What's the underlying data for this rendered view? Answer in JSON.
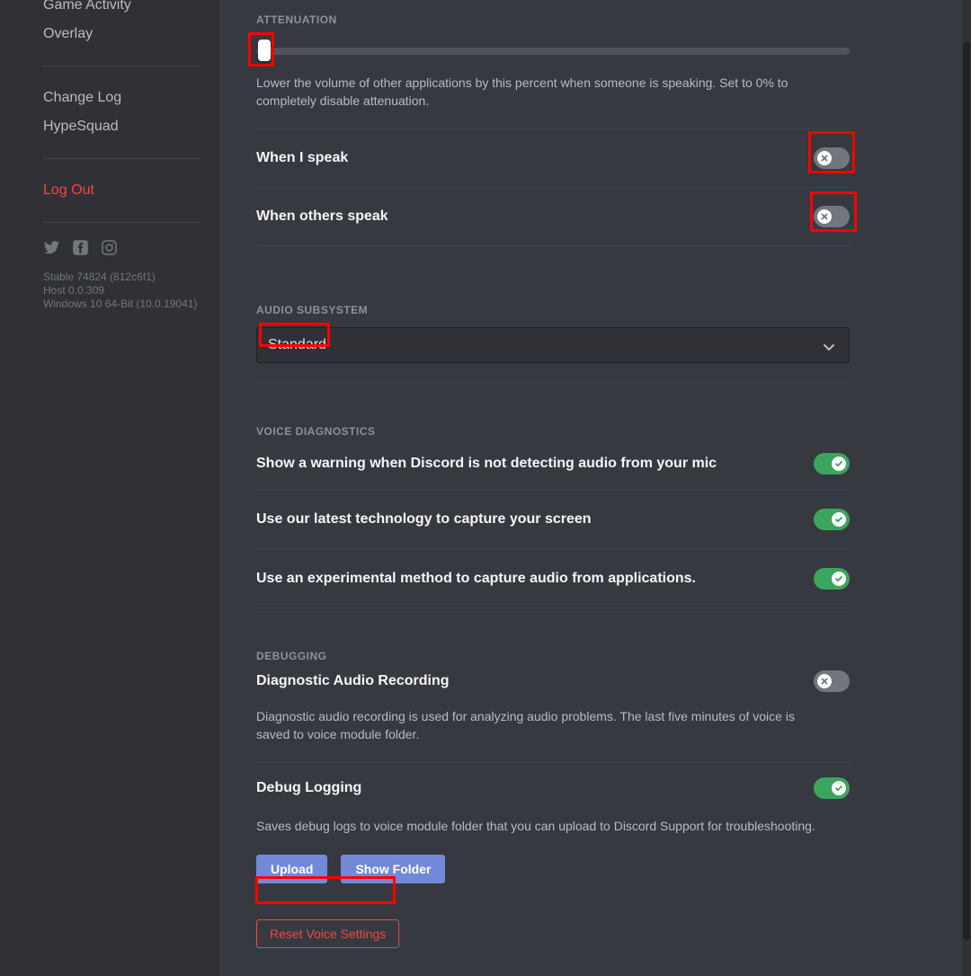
{
  "sidebar": {
    "nav_top": [
      {
        "label": "Game Activity",
        "style": "normal"
      },
      {
        "label": "Overlay",
        "style": "normal"
      }
    ],
    "nav_mid": [
      {
        "label": "Change Log",
        "style": "normal"
      },
      {
        "label": "HypeSquad",
        "style": "normal"
      }
    ],
    "nav_logout": {
      "label": "Log Out",
      "style": "danger"
    },
    "socials": [
      {
        "name": "twitter-icon"
      },
      {
        "name": "facebook-icon"
      },
      {
        "name": "instagram-icon"
      }
    ],
    "version": {
      "build": "Stable 74824 (812c6f1)",
      "host": "Host 0.0.309",
      "os": "Windows 10 64-Bit (10.0.19041)"
    }
  },
  "attenuation": {
    "header": "ATTENUATION",
    "slider_value": "0",
    "slider_min": "0",
    "slider_max": "100",
    "description": "Lower the volume of other applications by this percent when someone is speaking. Set to 0% to completely disable attenuation.",
    "rows": [
      {
        "label": "When I speak",
        "state": "off"
      },
      {
        "label": "When others speak",
        "state": "off"
      }
    ]
  },
  "audio_subsystem": {
    "header": "AUDIO SUBSYSTEM",
    "selected": "Standard",
    "chevron": "chevron-down-icon"
  },
  "voice_diagnostics": {
    "header": "VOICE DIAGNOSTICS",
    "rows": [
      {
        "label": "Show a warning when Discord is not detecting audio from your mic",
        "state": "on"
      },
      {
        "label": "Use our latest technology to capture your screen",
        "state": "on"
      },
      {
        "label": "Use an experimental method to capture audio from applications.",
        "state": "on"
      }
    ]
  },
  "debugging": {
    "header": "DEBUGGING",
    "diagnostic": {
      "label": "Diagnostic Audio Recording",
      "state": "off",
      "description": "Diagnostic audio recording is used for analyzing audio problems. The last five minutes of voice is saved to voice module folder."
    },
    "debug_logging": {
      "label": "Debug Logging",
      "state": "on",
      "description": "Saves debug logs to voice module folder that you can upload to Discord Support for troubleshooting."
    },
    "upload_label": "Upload",
    "show_folder_label": "Show Folder",
    "reset_label": "Reset Voice Settings"
  },
  "colors": {
    "accent_blurple": "#7289da",
    "danger_red": "#f04747",
    "toggle_on_green": "#3ba55d",
    "toggle_off_grey": "#72767d",
    "annotation_red": "#ff0000",
    "sidebar_bg": "#2f3136",
    "main_bg": "#36393f"
  }
}
